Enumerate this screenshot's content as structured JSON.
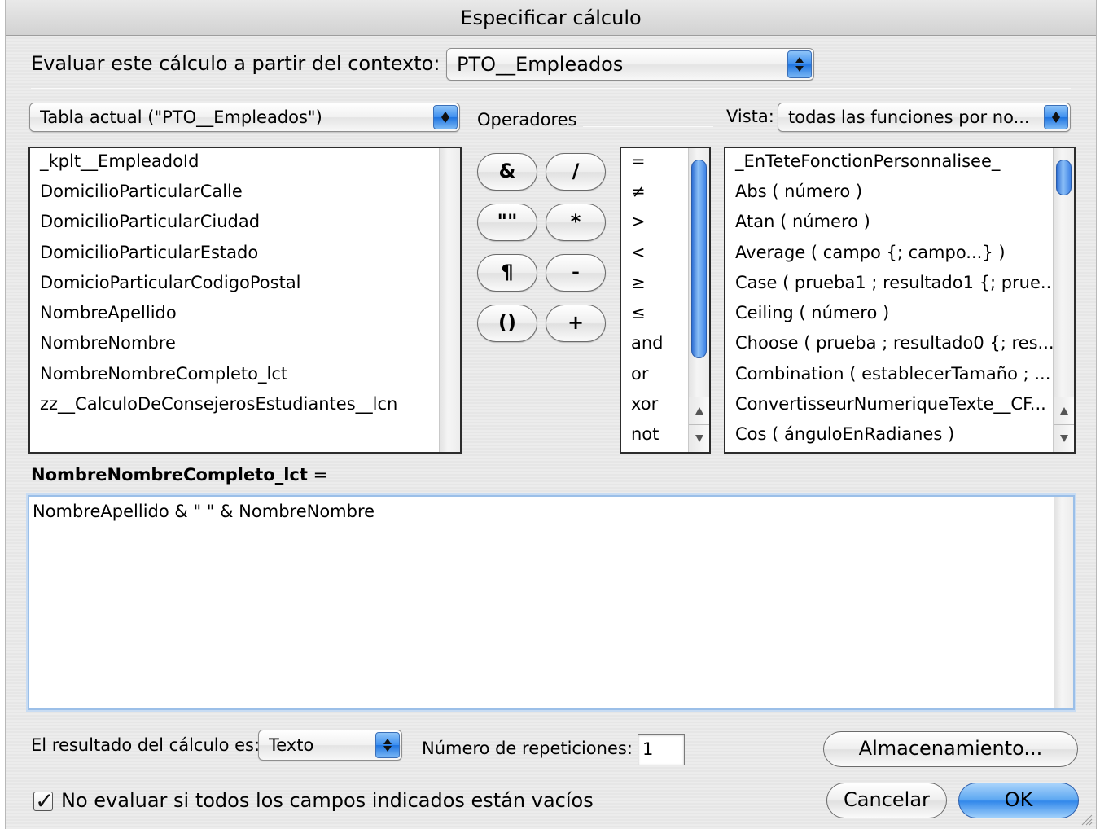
{
  "window": {
    "title": "Especificar cálculo"
  },
  "context": {
    "label": "Evaluar este cálculo a partir del contexto:",
    "selected": "PTO__Empleados"
  },
  "table_popup": {
    "selected": "Tabla actual (\"PTO__Empleados\")"
  },
  "operators": {
    "label": "Operadores",
    "buttons": [
      "&",
      "/",
      "\"\"",
      "*",
      "¶",
      "-",
      "()",
      "+"
    ],
    "list": [
      "=",
      "≠",
      ">",
      "<",
      "≥",
      "≤",
      "and",
      "or",
      "xor",
      "not"
    ]
  },
  "view": {
    "label": "Vista:",
    "selected": "todas las funciones por no..."
  },
  "fields": [
    "_kplt__EmpleadoId",
    "DomicilioParticularCalle",
    "DomicilioParticularCiudad",
    "DomicilioParticularEstado",
    "DomicioParticularCodigoPostal",
    "NombreApellido",
    "NombreNombre",
    "NombreNombreCompleto_lct",
    "zz__CalculoDeConsejerosEstudiantes__lcn"
  ],
  "functions": [
    "_EnTeteFonctionPersonnalisee_",
    "Abs ( número )",
    "Atan ( número )",
    "Average ( campo {; campo...} )",
    "Case ( prueba1 ; resultado1 {; prue...",
    "Ceiling ( número )",
    "Choose ( prueba ; resultado0 {; res...",
    "Combination ( establecerTamaño ; ...",
    "ConvertisseurNumeriqueTexte__CF...",
    "Cos ( ánguloEnRadianes )"
  ],
  "formula": {
    "field_name": "NombreNombreCompleto_lct",
    "equals": "=",
    "expression": "NombreApellido & \" \" & NombreNombre"
  },
  "result": {
    "label": "El resultado del cálculo es:",
    "type": "Texto",
    "repetitions_label": "Número de repeticiones:",
    "repetitions": "1"
  },
  "buttons": {
    "storage": "Almacenamiento...",
    "cancel": "Cancelar",
    "ok": "OK"
  },
  "checkbox": {
    "label": "No evaluar si todos los campos indicados están vacíos",
    "checked": true
  },
  "colors": {
    "accent": "#3d8ff0",
    "focus_ring": "#9bbfe8"
  }
}
